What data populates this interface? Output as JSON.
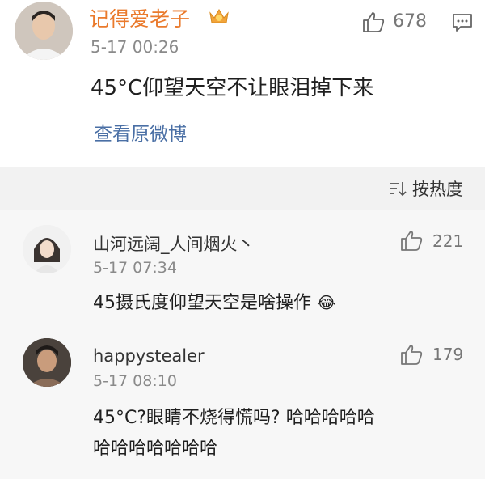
{
  "post": {
    "author": "记得爱老子",
    "time": "5-17 00:26",
    "likes": "678",
    "text": "45°C仰望天空不让眼泪掉下来",
    "view_link": "查看原微博"
  },
  "sort": {
    "label": "按热度"
  },
  "comments": [
    {
      "author": "山河远阔_人间烟火丶",
      "time": "5-17 07:34",
      "likes": "221",
      "text": "45摄氏度仰望天空是啥操作",
      "emoji": "😂"
    },
    {
      "author": "happystealer",
      "time": "5-17 08:10",
      "likes": "179",
      "line1": "45°C?眼睛不烧得慌吗? 哈哈哈哈哈",
      "line2": "哈哈哈哈哈哈哈"
    }
  ],
  "colors": {
    "author_orange": "#ea7a2c",
    "link_blue": "#4a6fa5",
    "grey": "#8a8a8a",
    "text": "#1f1f1f"
  }
}
